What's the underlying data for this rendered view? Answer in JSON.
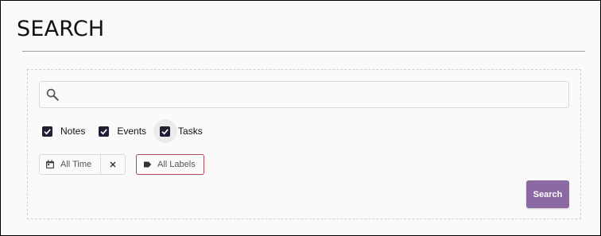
{
  "page": {
    "title": "SEARCH"
  },
  "search": {
    "value": "",
    "placeholder": ""
  },
  "filters": {
    "notes": {
      "label": "Notes",
      "checked": true
    },
    "events": {
      "label": "Events",
      "checked": true
    },
    "tasks": {
      "label": "Tasks",
      "checked": true
    }
  },
  "date_range": {
    "label": "All Time"
  },
  "labels_filter": {
    "label": "All Labels"
  },
  "actions": {
    "search_label": "Search"
  },
  "colors": {
    "checkbox": "#1f1f36",
    "search_button": "#8b6aa2",
    "labels_border": "#b04a57"
  },
  "icons": [
    "search-icon",
    "calendar-icon",
    "close-icon",
    "label-tag-icon",
    "check-icon"
  ]
}
